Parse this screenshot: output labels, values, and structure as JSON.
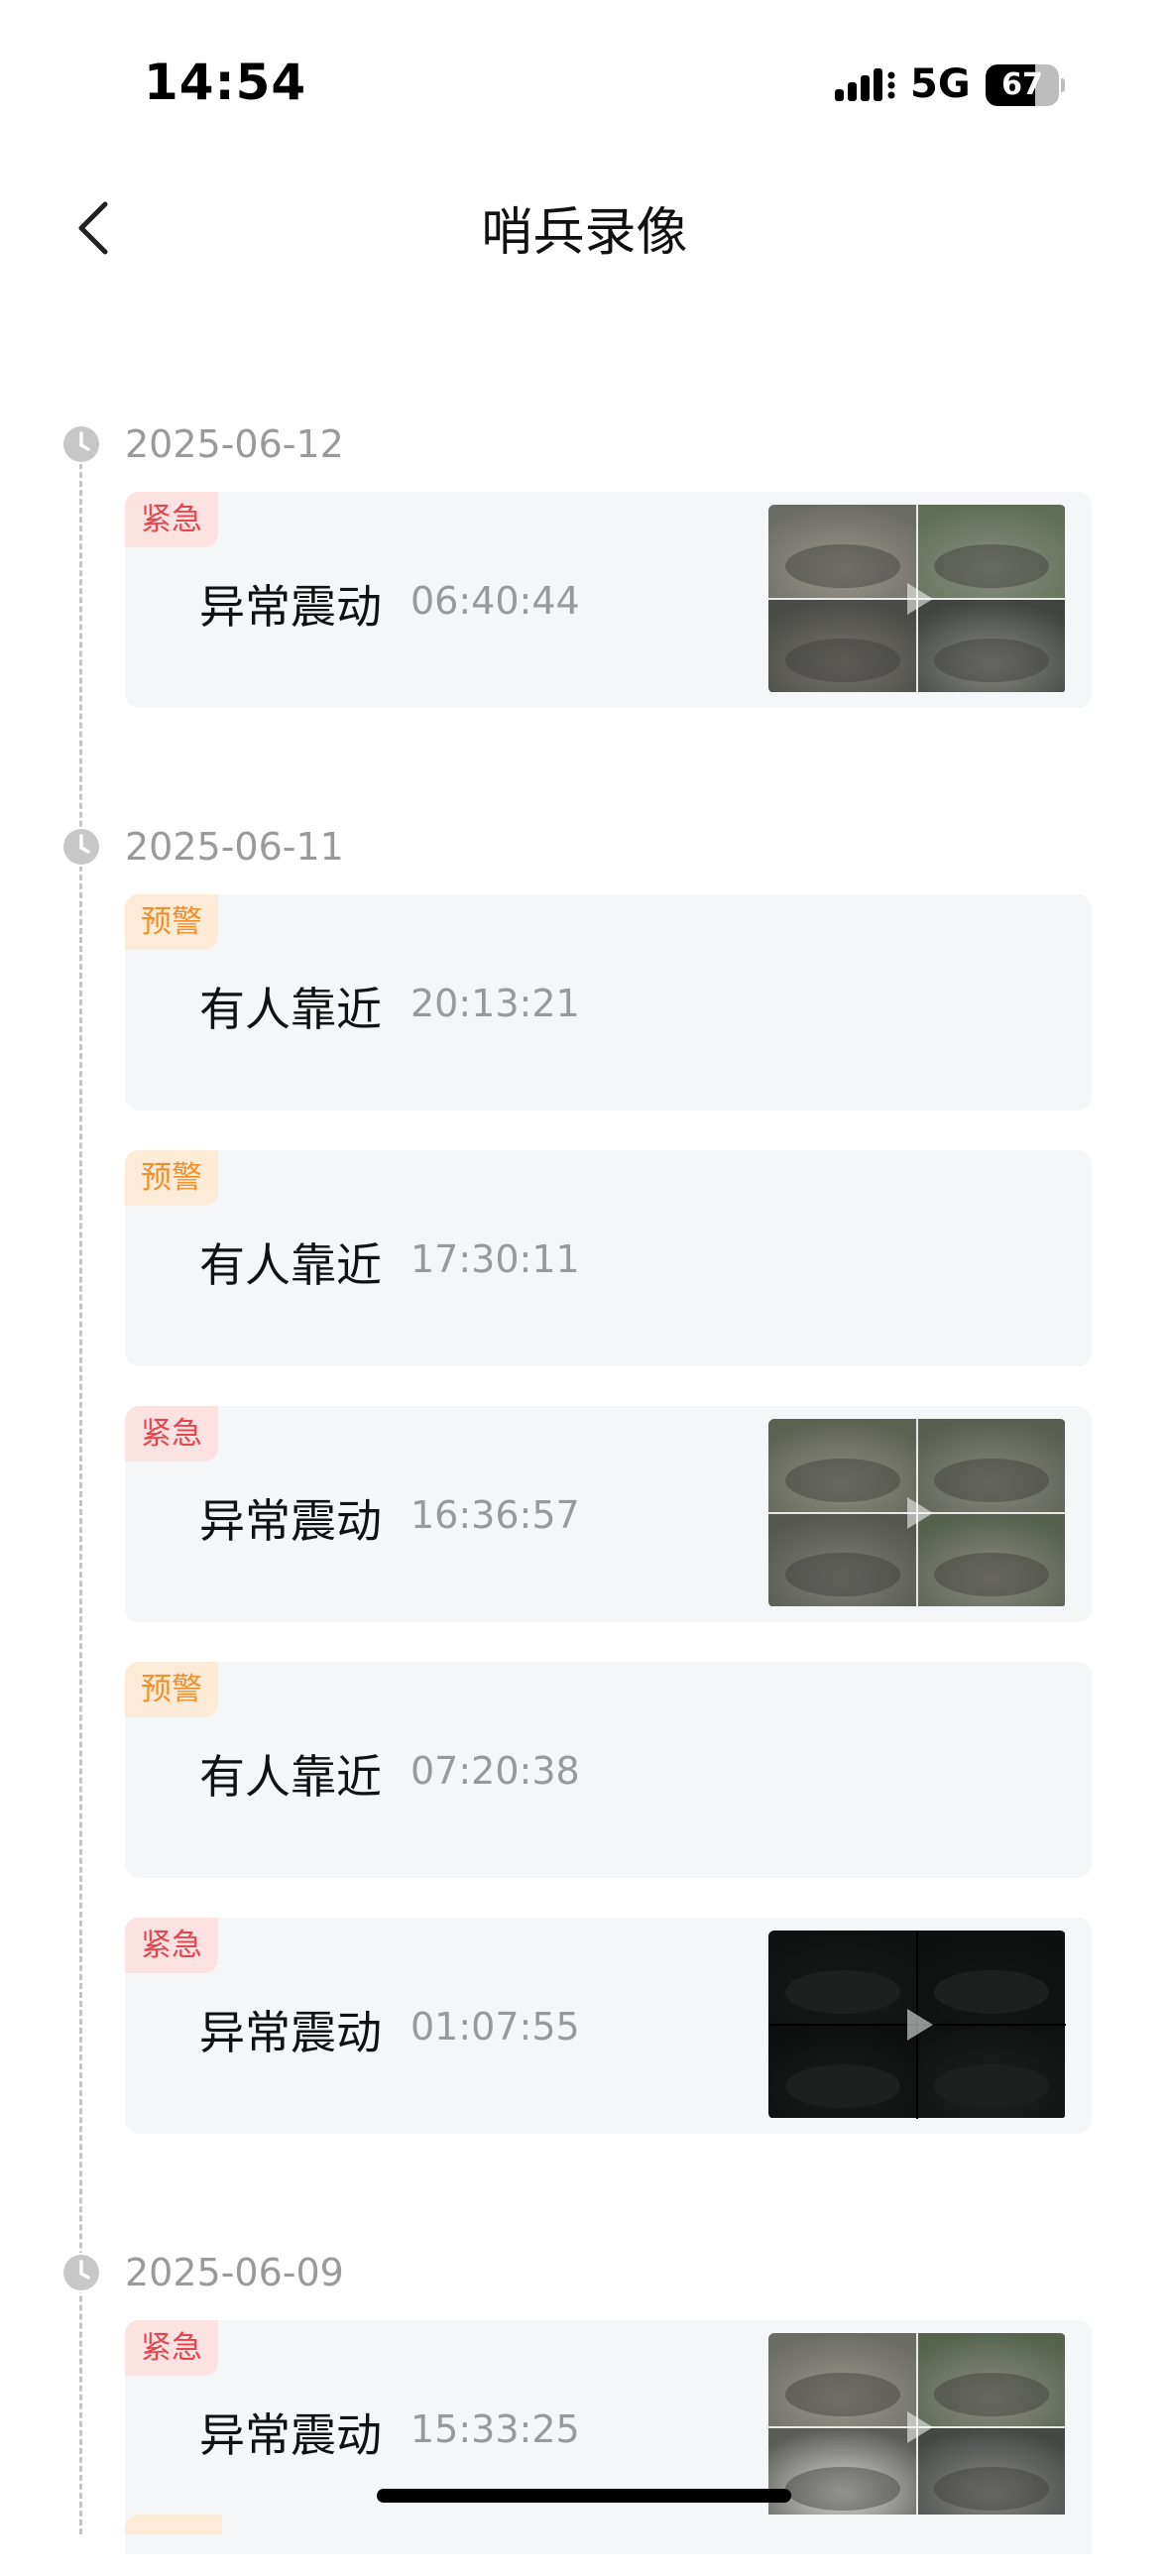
{
  "status_bar": {
    "time": "14:54",
    "network": "5G",
    "battery_level": "67",
    "battery_fraction": 0.67
  },
  "header": {
    "title": "哨兵录像",
    "back_icon": "chevron-left-icon"
  },
  "timeline": [
    {
      "date": "2025-06-12",
      "events": [
        {
          "level": "紧急",
          "level_type": "urgent",
          "title": "异常震动",
          "time": "06:40:44",
          "has_thumbnail": true,
          "thumb_style": "day-a"
        }
      ]
    },
    {
      "date": "2025-06-11",
      "events": [
        {
          "level": "预警",
          "level_type": "warning",
          "title": "有人靠近",
          "time": "20:13:21",
          "has_thumbnail": false
        },
        {
          "level": "预警",
          "level_type": "warning",
          "title": "有人靠近",
          "time": "17:30:11",
          "has_thumbnail": false
        },
        {
          "level": "紧急",
          "level_type": "urgent",
          "title": "异常震动",
          "time": "16:36:57",
          "has_thumbnail": true,
          "thumb_style": "day-b"
        },
        {
          "level": "预警",
          "level_type": "warning",
          "title": "有人靠近",
          "time": "07:20:38",
          "has_thumbnail": false
        },
        {
          "level": "紧急",
          "level_type": "urgent",
          "title": "异常震动",
          "time": "01:07:55",
          "has_thumbnail": true,
          "thumb_style": "night"
        }
      ]
    },
    {
      "date": "2025-06-09",
      "events": [
        {
          "level": "紧急",
          "level_type": "urgent",
          "title": "异常震动",
          "time": "15:33:25",
          "has_thumbnail": true,
          "thumb_style": "day-c"
        }
      ]
    }
  ],
  "colors": {
    "urgent_text": "#e4464e",
    "urgent_bg": "#fde2e2",
    "warning_text": "#f0902c",
    "warning_bg": "#fcebd7",
    "card_bg": "#f5f6f8",
    "muted_text": "#999999"
  },
  "icons": {
    "timeline_marker": "clock-icon",
    "thumbnail_overlay": "play-icon"
  }
}
